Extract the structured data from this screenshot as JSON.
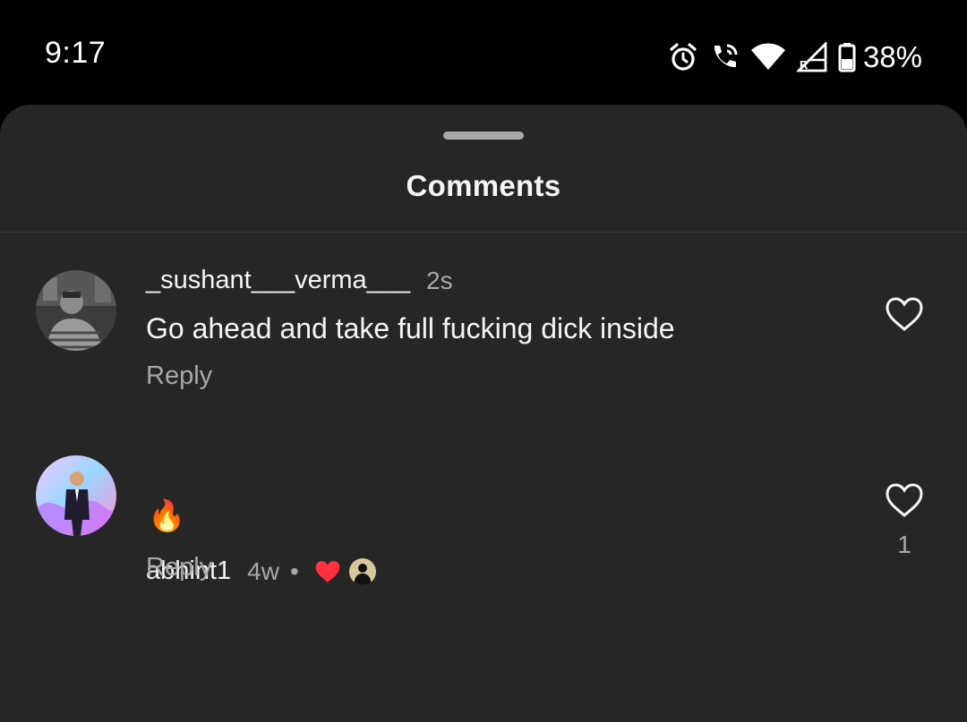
{
  "status_bar": {
    "time": "9:17",
    "battery": "38%",
    "icons": [
      "alarm-icon",
      "wifi-call-icon",
      "wifi-icon",
      "cell-signal-roaming-icon",
      "battery-icon"
    ]
  },
  "sheet": {
    "title": "Comments"
  },
  "comments": [
    {
      "username": "_sushant___verma___",
      "time": "2s",
      "text": "Go ahead and take full fucking dick inside",
      "reply_label": "Reply",
      "like_count": ""
    },
    {
      "username": "abhint1",
      "time": "4w",
      "separator": "•",
      "text": "🔥",
      "reply_label": "Reply",
      "like_count": "1",
      "liked_by_author": true
    }
  ],
  "colors": {
    "sheet_background": "#262626",
    "primary_text": "#f5f5f5",
    "secondary_text": "#a8a8a8",
    "heart_red": "#ff3040"
  }
}
